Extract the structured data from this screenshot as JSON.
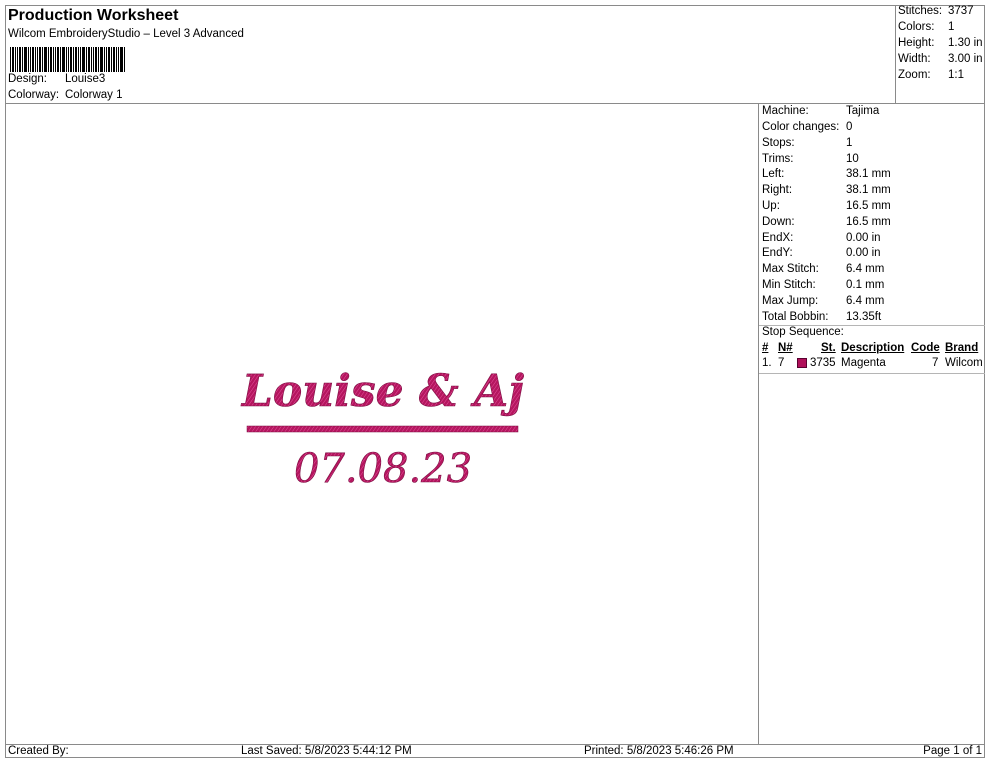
{
  "header": {
    "title": "Production Worksheet",
    "subtitle": "Wilcom EmbroideryStudio – Level 3 Advanced",
    "design_label": "Design:",
    "design_value": "Louise3",
    "colorway_label": "Colorway:",
    "colorway_value": "Colorway 1"
  },
  "summary": [
    {
      "label": "Stitches:",
      "value": "3737"
    },
    {
      "label": "Colors:",
      "value": "1"
    },
    {
      "label": "Height:",
      "value": "1.30 in"
    },
    {
      "label": "Width:",
      "value": "3.00 in"
    },
    {
      "label": "Zoom:",
      "value": "1:1"
    }
  ],
  "design": {
    "line1": "Louise & Aj",
    "line2": "07.08.23",
    "thread_color": "#b5165f",
    "highlight_color": "#e34f9a"
  },
  "machine_info": [
    {
      "label": "Machine:",
      "value": "Tajima"
    },
    {
      "label": "Color changes:",
      "value": "0"
    },
    {
      "label": "Stops:",
      "value": "1"
    },
    {
      "label": "Trims:",
      "value": "10"
    },
    {
      "label": "Left:",
      "value": "38.1 mm"
    },
    {
      "label": "Right:",
      "value": "38.1 mm"
    },
    {
      "label": "Up:",
      "value": "16.5 mm"
    },
    {
      "label": "Down:",
      "value": "16.5 mm"
    },
    {
      "label": "EndX:",
      "value": "0.00 in"
    },
    {
      "label": "EndY:",
      "value": "0.00 in"
    },
    {
      "label": "Max Stitch:",
      "value": "6.4 mm"
    },
    {
      "label": "Min Stitch:",
      "value": "0.1 mm"
    },
    {
      "label": "Max Jump:",
      "value": "6.4 mm"
    },
    {
      "label": "Total Bobbin:",
      "value": "13.35ft"
    }
  ],
  "stop_sequence": {
    "title": "Stop Sequence:",
    "columns": {
      "num": "#",
      "n": "N#",
      "st": "St.",
      "description": "Description",
      "code": "Code",
      "brand": "Brand"
    },
    "rows": [
      {
        "num": "1.",
        "n": "7",
        "swatch": "#b0105a",
        "st": "3735",
        "description": "Magenta",
        "code": "7",
        "brand": "Wilcom"
      }
    ]
  },
  "footer": {
    "created_by": "Created By:",
    "last_saved": "Last Saved: 5/8/2023 5:44:12 PM",
    "printed": "Printed: 5/8/2023 5:46:26 PM",
    "page": "Page 1 of 1"
  }
}
